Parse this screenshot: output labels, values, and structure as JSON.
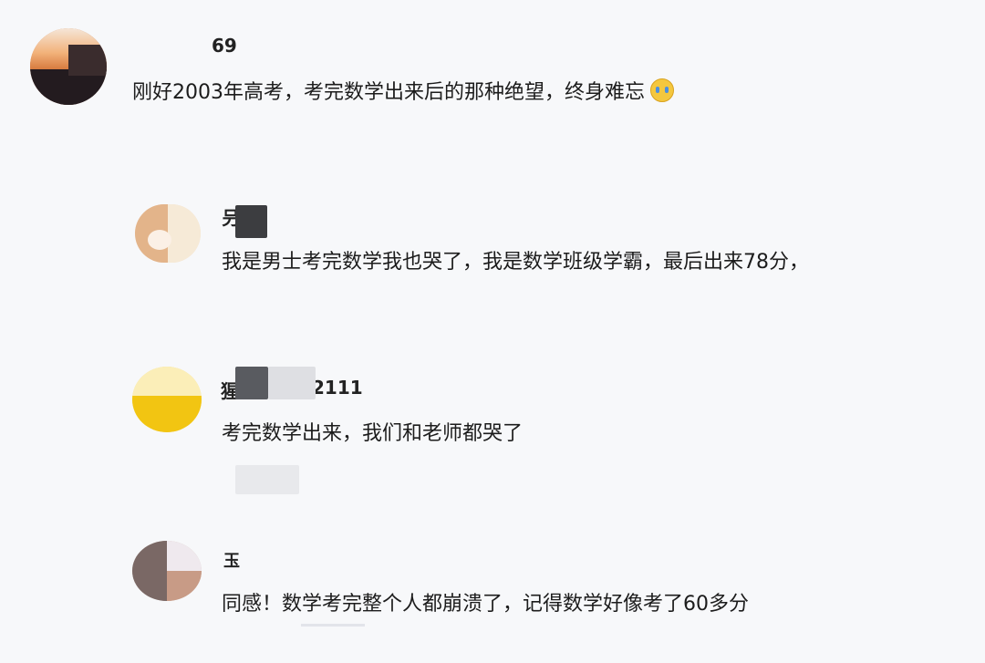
{
  "comments": [
    {
      "username": "69",
      "text": "刚好2003年高考，考完数学出来后的那种绝望，终身难忘",
      "emoji_icon": "crying-face-icon"
    }
  ],
  "replies": [
    {
      "username": "叧",
      "text": "我是男士考完数学我也哭了，我是数学班级学霸，最后出来78分，"
    },
    {
      "username_prefix": "猩",
      "username_suffix": "2111",
      "text": "考完数学出来，我们和老师都哭了"
    },
    {
      "username": "玉",
      "text": "同感！数学考完整个人都崩溃了，记得数学好像考了60多分"
    }
  ]
}
